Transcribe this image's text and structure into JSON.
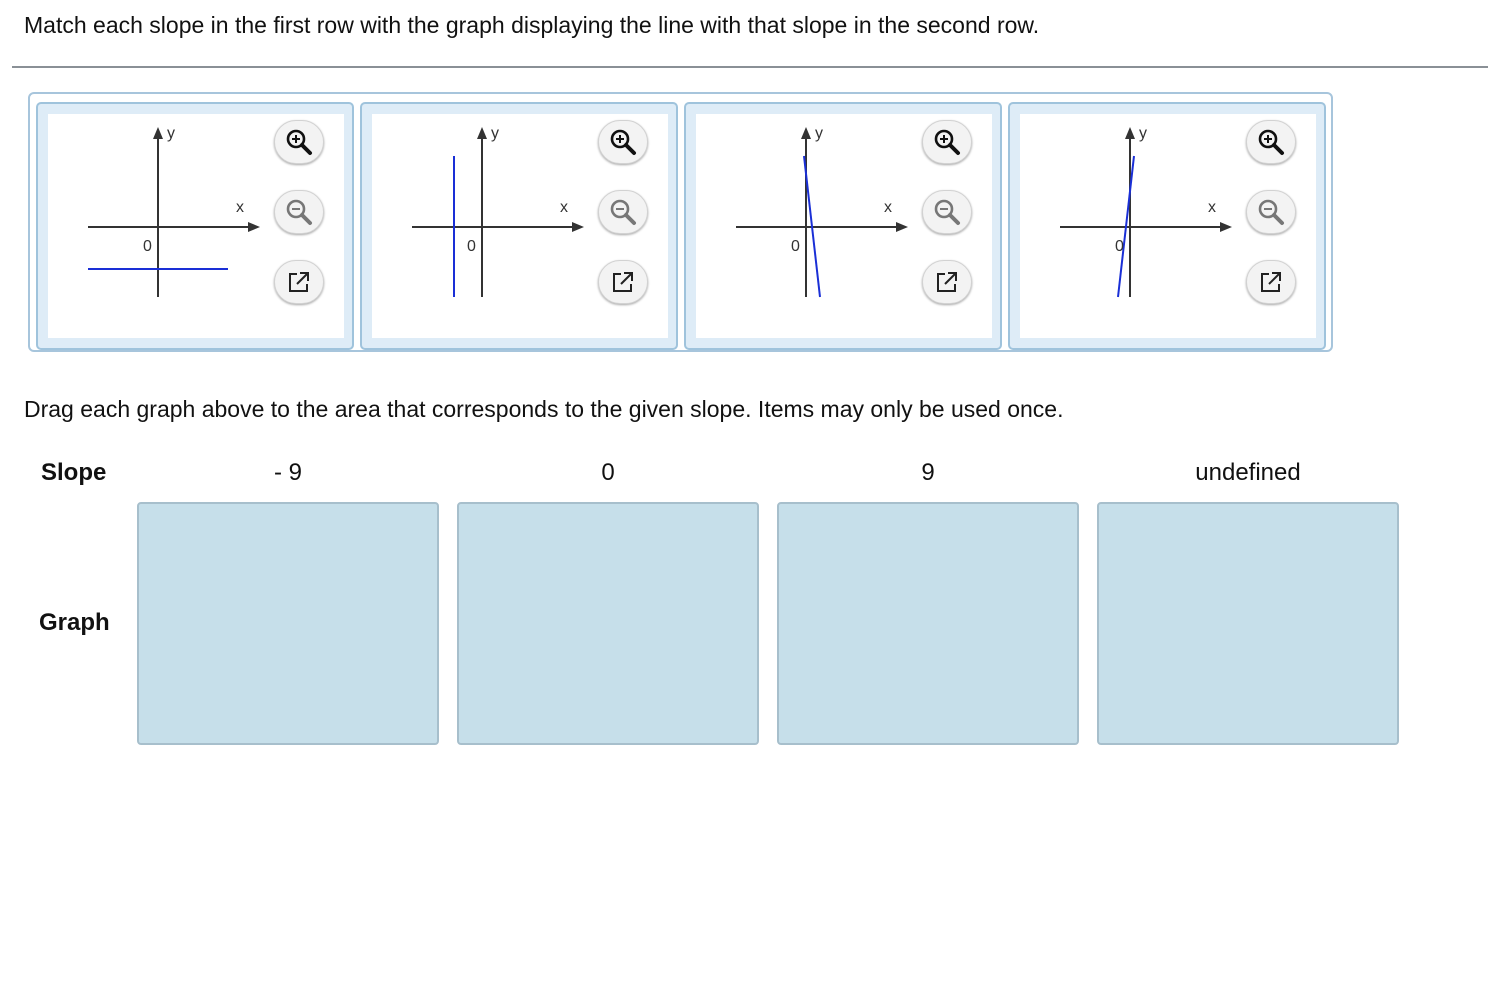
{
  "instruction": "Match each slope in the first row with the graph displaying the line with that slope in the second row.",
  "graph_cards": [
    {
      "y_label": "y",
      "x_label": "x",
      "origin_label": "0",
      "line": "horizontal, below x-axis"
    },
    {
      "y_label": "y",
      "x_label": "x",
      "origin_label": "0",
      "line": "vertical, left of y-axis"
    },
    {
      "y_label": "y",
      "x_label": "x",
      "origin_label": "0",
      "line": "steep, negative slope"
    },
    {
      "y_label": "y",
      "x_label": "x",
      "origin_label": "0",
      "line": "steep, positive slope"
    }
  ],
  "tool_icons": [
    "zoom-in-icon",
    "zoom-out-icon",
    "open-new-window-icon"
  ],
  "drag_instruction": "Drag each graph above to the area that corresponds to the given slope. Items may only be used once.",
  "slope_row_label": "Slope",
  "graph_row_label": "Graph",
  "slopes": [
    "- 9",
    "0",
    "9",
    "undefined"
  ],
  "colors": {
    "line": "#1a2fd6",
    "axis": "#333333",
    "card_border": "#9fc3dc",
    "card_bg": "#deecf7",
    "drop_zone_bg": "#c6dfea"
  }
}
